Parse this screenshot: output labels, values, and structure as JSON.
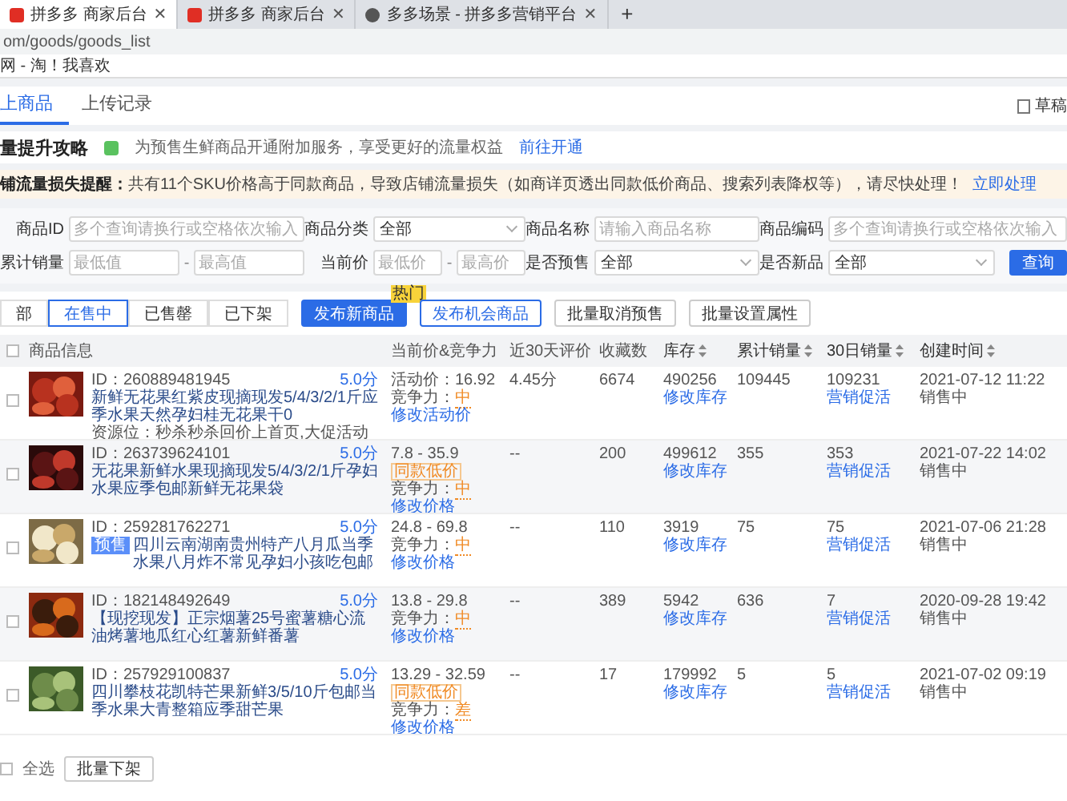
{
  "browser": {
    "tabs": [
      {
        "title": "拼多多 商家后台",
        "selected": true,
        "close": "✕"
      },
      {
        "title": "拼多多 商家后台",
        "selected": false,
        "close": "✕"
      },
      {
        "title": "多多场景 - 拼多多营销平台",
        "selected": false,
        "close": "✕"
      }
    ],
    "new_tab": "+",
    "address": "om/goods/goods_list",
    "bookmark": "网 - 淘！我喜欢"
  },
  "page_tabs": [
    {
      "label": "上商品",
      "selected": true
    },
    {
      "label": "上传记录",
      "selected": false
    }
  ],
  "drafts": "草稿",
  "banner": {
    "title": "量提升攻略",
    "text": "为预售生鲜商品开通附加服务，享受更好的流量权益",
    "link": "前往开通"
  },
  "notice": {
    "text": "**铺流量损失提醒：**共有11个SKU价格高于同款商品，导致店铺流量损失（如商详页透出同款低价商品、搜索列表降权等），请尽快处理！",
    "link": "立即处理"
  },
  "filters": [
    {
      "label": "商品ID",
      "kind": "input",
      "placeholder": "多个查询请换行或空格依次输入"
    },
    {
      "label": "商品分类",
      "kind": "select",
      "value": "全部"
    },
    {
      "label": "商品名称",
      "kind": "input",
      "placeholder": "请输入商品名称"
    },
    {
      "label": "商品编码",
      "kind": "input",
      "placeholder": "多个查询请换行或空格依次输入"
    },
    {
      "label": "累计销量",
      "kind": "range",
      "inputs": [
        {
          "placeholder": "最低值"
        },
        {
          "placeholder": "最高值"
        }
      ],
      "dash": "-"
    },
    {
      "label": "当前价",
      "kind": "range",
      "inputs": [
        {
          "placeholder": "最低价"
        },
        {
          "placeholder": "最高价"
        }
      ],
      "dash": "-"
    },
    {
      "label": "是否预售",
      "kind": "select",
      "value": "全部"
    },
    {
      "label": "是否新品",
      "kind": "select",
      "value": "全部"
    }
  ],
  "query_button": "查询",
  "status_tabs": [
    {
      "label": "部",
      "selected": false
    },
    {
      "label": "在售中",
      "selected": true
    },
    {
      "label": "已售罄",
      "selected": false
    },
    {
      "label": "已下架",
      "selected": false
    }
  ],
  "actions": [
    {
      "label": "发布新商品",
      "kind": "primary",
      "badge": "热门"
    },
    {
      "label": "发布机会商品",
      "kind": "outline"
    },
    {
      "label": "批量取消预售",
      "kind": "plain"
    },
    {
      "label": "批量设置属性",
      "kind": "plain"
    }
  ],
  "header_checked": false,
  "columns": [
    {
      "label": "商品信息",
      "sortable": false
    },
    {
      "label": "当前价&竞争力",
      "sortable": false
    },
    {
      "label": "近30天评价",
      "sortable": false
    },
    {
      "label": "收藏数",
      "sortable": false
    },
    {
      "label": "库存",
      "sortable": true
    },
    {
      "label": "累计销量",
      "sortable": true
    },
    {
      "label": "30日销量",
      "sortable": true
    },
    {
      "label": "创建时间",
      "sortable": true
    }
  ],
  "rows": [
    {
      "checked": false,
      "id": "ID：260889481945",
      "score": "5.0分",
      "tag": null,
      "title": "新鲜无花果红紫皮现摘现发5/4/3/2/1斤应季水果天然孕妇桂无花果干0",
      "extra": "资源位：秒杀秒杀回价上首页,大促活动",
      "price": [
        {
          "kind": "price",
          "text": "活动价：16.92"
        },
        {
          "kind": "competition",
          "label": "竞争力：",
          "value": "中"
        },
        {
          "kind": "link",
          "text": "修改活动价"
        }
      ],
      "rating": "4.45分",
      "favorites": "6674",
      "stock": "490256",
      "stock_link": "修改库存",
      "sales": "109445",
      "sales30": "109231",
      "sales30_link": "营销促活",
      "created": "2021-07-12 11:22",
      "status": "销售中"
    },
    {
      "checked": false,
      "id": "ID：263739624101",
      "score": "5.0分",
      "tag": null,
      "title": "无花果新鲜水果现摘现发5/4/3/2/1斤孕妇水果应季包邮新鲜无花果袋",
      "extra": null,
      "price": [
        {
          "kind": "price",
          "text": "7.8 - 35.9"
        },
        {
          "kind": "tag",
          "text": "同款低价"
        },
        {
          "kind": "competition",
          "label": "竞争力：",
          "value": "中"
        },
        {
          "kind": "link",
          "text": "修改价格"
        }
      ],
      "rating": "--",
      "favorites": "200",
      "stock": "499612",
      "stock_link": "修改库存",
      "sales": "355",
      "sales30": "353",
      "sales30_link": "营销促活",
      "created": "2021-07-22 14:02",
      "status": "销售中"
    },
    {
      "checked": false,
      "id": "ID：259281762271",
      "score": "5.0分",
      "tag": "预售",
      "title": "四川云南湖南贵州特产八月瓜当季水果八月炸不常见孕妇小孩吃包邮",
      "extra": null,
      "price": [
        {
          "kind": "price",
          "text": "24.8 - 69.8"
        },
        {
          "kind": "competition",
          "label": "竞争力：",
          "value": "中"
        },
        {
          "kind": "link",
          "text": "修改价格"
        }
      ],
      "rating": "--",
      "favorites": "110",
      "stock": "3919",
      "stock_link": "修改库存",
      "sales": "75",
      "sales30": "75",
      "sales30_link": "营销促活",
      "created": "2021-07-06 21:28",
      "status": "销售中"
    },
    {
      "checked": false,
      "id": "ID：182148492649",
      "score": "5.0分",
      "tag": null,
      "title": "【现挖现发】正宗烟薯25号蜜薯糖心流油烤薯地瓜红心红薯新鲜番薯",
      "extra": null,
      "price": [
        {
          "kind": "price",
          "text": "13.8 - 29.8"
        },
        {
          "kind": "competition",
          "label": "竞争力：",
          "value": "中"
        },
        {
          "kind": "link",
          "text": "修改价格"
        }
      ],
      "rating": "--",
      "favorites": "389",
      "stock": "5942",
      "stock_link": "修改库存",
      "sales": "636",
      "sales30": "7",
      "sales30_link": "营销促活",
      "created": "2020-09-28 19:42",
      "status": "销售中"
    },
    {
      "checked": false,
      "id": "ID：257929100837",
      "score": "5.0分",
      "tag": null,
      "title": "四川攀枝花凯特芒果新鲜3/5/10斤包邮当季水果大青整箱应季甜芒果",
      "extra": null,
      "price": [
        {
          "kind": "price",
          "text": "13.29 - 32.59"
        },
        {
          "kind": "tag",
          "text": "同款低价"
        },
        {
          "kind": "competition",
          "label": "竞争力：",
          "value": "差"
        },
        {
          "kind": "link",
          "text": "修改价格"
        }
      ],
      "rating": "--",
      "favorites": "17",
      "stock": "179992",
      "stock_link": "修改库存",
      "sales": "5",
      "sales30": "5",
      "sales30_link": "营销促活",
      "created": "2021-07-02 09:19",
      "status": "销售中"
    }
  ],
  "footer": {
    "checked": false,
    "select_all": "全选",
    "button": "批量下架"
  }
}
